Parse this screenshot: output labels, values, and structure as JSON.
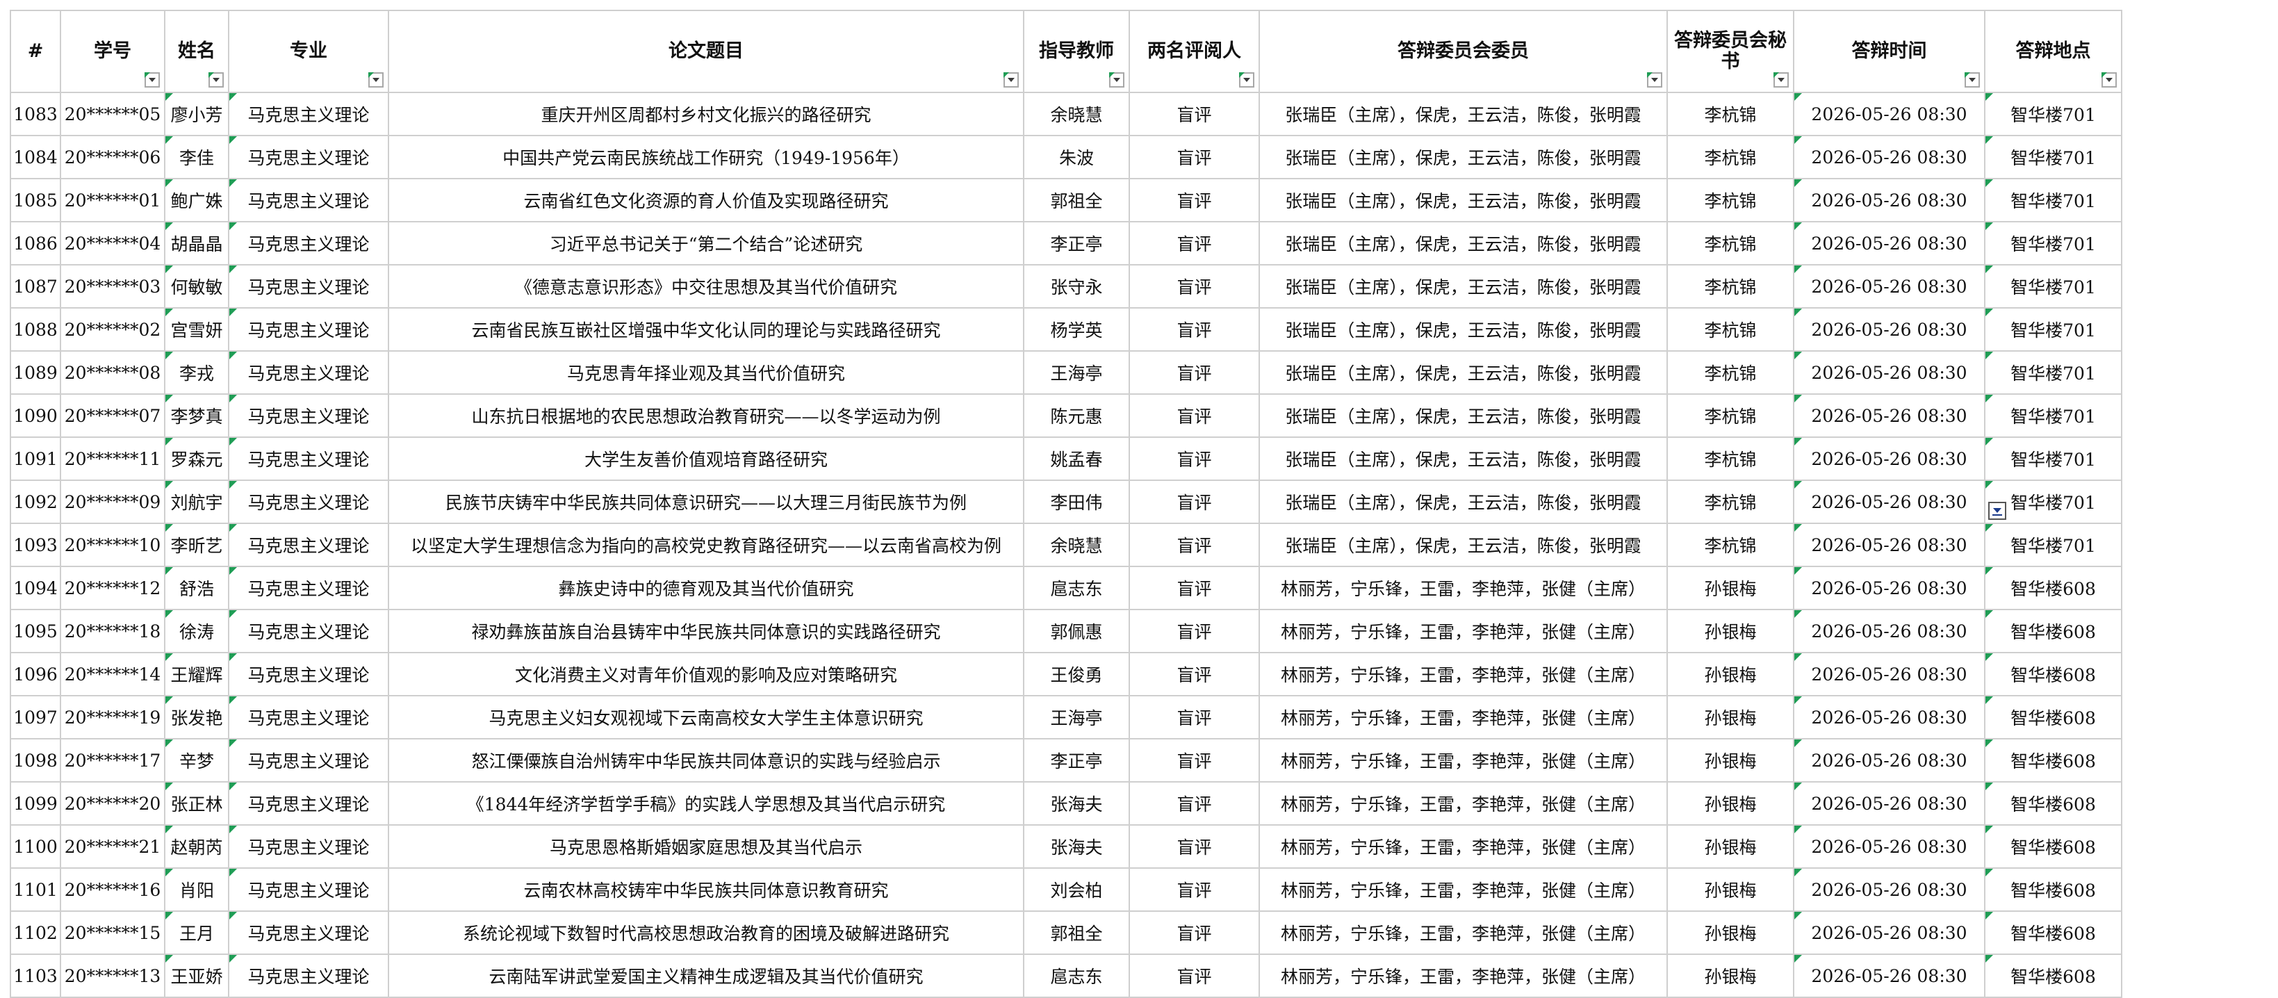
{
  "headers": {
    "num": "#",
    "student_id": "学号",
    "name": "姓名",
    "major": "专业",
    "title": "论文题目",
    "advisor": "指导教师",
    "reviewers": "两名评阅人",
    "committee": "答辩委员会委员",
    "secretary": "答辩委员会秘书",
    "time": "答辩时间",
    "location": "答辩地点"
  },
  "rows": [
    {
      "num": "1083",
      "id": "20******05",
      "name": "廖小芳",
      "major": "马克思主义理论",
      "title": "重庆开州区周都村乡村文化振兴的路径研究",
      "advisor": "余晓慧",
      "reviewers": "盲评",
      "committee": "张瑞臣（主席），保虎，王云洁，陈俊，张明霞",
      "secretary": "李杭锦",
      "time": "2026-05-26 08:30",
      "location": "智华楼701"
    },
    {
      "num": "1084",
      "id": "20******06",
      "name": "李佳",
      "major": "马克思主义理论",
      "title": "中国共产党云南民族统战工作研究（1949-1956年）",
      "advisor": "朱波",
      "reviewers": "盲评",
      "committee": "张瑞臣（主席），保虎，王云洁，陈俊，张明霞",
      "secretary": "李杭锦",
      "time": "2026-05-26 08:30",
      "location": "智华楼701"
    },
    {
      "num": "1085",
      "id": "20******01",
      "name": "鲍广姝",
      "major": "马克思主义理论",
      "title": "云南省红色文化资源的育人价值及实现路径研究",
      "advisor": "郭祖全",
      "reviewers": "盲评",
      "committee": "张瑞臣（主席），保虎，王云洁，陈俊，张明霞",
      "secretary": "李杭锦",
      "time": "2026-05-26 08:30",
      "location": "智华楼701"
    },
    {
      "num": "1086",
      "id": "20******04",
      "name": "胡晶晶",
      "major": "马克思主义理论",
      "title": "习近平总书记关于“第二个结合”论述研究",
      "advisor": "李正亭",
      "reviewers": "盲评",
      "committee": "张瑞臣（主席），保虎，王云洁，陈俊，张明霞",
      "secretary": "李杭锦",
      "time": "2026-05-26 08:30",
      "location": "智华楼701"
    },
    {
      "num": "1087",
      "id": "20******03",
      "name": "何敏敏",
      "major": "马克思主义理论",
      "title": "《德意志意识形态》中交往思想及其当代价值研究",
      "advisor": "张守永",
      "reviewers": "盲评",
      "committee": "张瑞臣（主席），保虎，王云洁，陈俊，张明霞",
      "secretary": "李杭锦",
      "time": "2026-05-26 08:30",
      "location": "智华楼701"
    },
    {
      "num": "1088",
      "id": "20******02",
      "name": "宫雪妍",
      "major": "马克思主义理论",
      "title": "云南省民族互嵌社区增强中华文化认同的理论与实践路径研究",
      "advisor": "杨学英",
      "reviewers": "盲评",
      "committee": "张瑞臣（主席），保虎，王云洁，陈俊，张明霞",
      "secretary": "李杭锦",
      "time": "2026-05-26 08:30",
      "location": "智华楼701"
    },
    {
      "num": "1089",
      "id": "20******08",
      "name": "李戎",
      "major": "马克思主义理论",
      "title": "马克思青年择业观及其当代价值研究",
      "advisor": "王海亭",
      "reviewers": "盲评",
      "committee": "张瑞臣（主席），保虎，王云洁，陈俊，张明霞",
      "secretary": "李杭锦",
      "time": "2026-05-26 08:30",
      "location": "智华楼701"
    },
    {
      "num": "1090",
      "id": "20******07",
      "name": "李梦真",
      "major": "马克思主义理论",
      "title": "山东抗日根据地的农民思想政治教育研究——以冬学运动为例",
      "advisor": "陈元惠",
      "reviewers": "盲评",
      "committee": "张瑞臣（主席），保虎，王云洁，陈俊，张明霞",
      "secretary": "李杭锦",
      "time": "2026-05-26 08:30",
      "location": "智华楼701"
    },
    {
      "num": "1091",
      "id": "20******11",
      "name": "罗森元",
      "major": "马克思主义理论",
      "title": "大学生友善价值观培育路径研究",
      "advisor": "姚孟春",
      "reviewers": "盲评",
      "committee": "张瑞臣（主席），保虎，王云洁，陈俊，张明霞",
      "secretary": "李杭锦",
      "time": "2026-05-26 08:30",
      "location": "智华楼701"
    },
    {
      "num": "1092",
      "id": "20******09",
      "name": "刘航宇",
      "major": "马克思主义理论",
      "title": "民族节庆铸牢中华民族共同体意识研究——以大理三月街民族节为例",
      "advisor": "李田伟",
      "reviewers": "盲评",
      "committee": "张瑞臣（主席），保虎，王云洁，陈俊，张明霞",
      "secretary": "李杭锦",
      "time": "2026-05-26 08:30",
      "location": "智华楼701"
    },
    {
      "num": "1093",
      "id": "20******10",
      "name": "李昕艺",
      "major": "马克思主义理论",
      "title": "以坚定大学生理想信念为指向的高校党史教育路径研究——以云南省高校为例",
      "advisor": "余晓慧",
      "reviewers": "盲评",
      "committee": "张瑞臣（主席），保虎，王云洁，陈俊，张明霞",
      "secretary": "李杭锦",
      "time": "2026-05-26 08:30",
      "location": "智华楼701"
    },
    {
      "num": "1094",
      "id": "20******12",
      "name": "舒浩",
      "major": "马克思主义理论",
      "title": "彝族史诗中的德育观及其当代价值研究",
      "advisor": "扈志东",
      "reviewers": "盲评",
      "committee": "林丽芳，宁乐锋，王雷，李艳萍，张健（主席）",
      "secretary": "孙银梅",
      "time": "2026-05-26 08:30",
      "location": "智华楼608"
    },
    {
      "num": "1095",
      "id": "20******18",
      "name": "徐涛",
      "major": "马克思主义理论",
      "title": "禄劝彝族苗族自治县铸牢中华民族共同体意识的实践路径研究",
      "advisor": "郭佩惠",
      "reviewers": "盲评",
      "committee": "林丽芳，宁乐锋，王雷，李艳萍，张健（主席）",
      "secretary": "孙银梅",
      "time": "2026-05-26 08:30",
      "location": "智华楼608"
    },
    {
      "num": "1096",
      "id": "20******14",
      "name": "王耀辉",
      "major": "马克思主义理论",
      "title": "文化消费主义对青年价值观的影响及应对策略研究",
      "advisor": "王俊勇",
      "reviewers": "盲评",
      "committee": "林丽芳，宁乐锋，王雷，李艳萍，张健（主席）",
      "secretary": "孙银梅",
      "time": "2026-05-26 08:30",
      "location": "智华楼608"
    },
    {
      "num": "1097",
      "id": "20******19",
      "name": "张发艳",
      "major": "马克思主义理论",
      "title": "马克思主义妇女观视域下云南高校女大学生主体意识研究",
      "advisor": "王海亭",
      "reviewers": "盲评",
      "committee": "林丽芳，宁乐锋，王雷，李艳萍，张健（主席）",
      "secretary": "孙银梅",
      "time": "2026-05-26 08:30",
      "location": "智华楼608"
    },
    {
      "num": "1098",
      "id": "20******17",
      "name": "辛梦",
      "major": "马克思主义理论",
      "title": "怒江傈僳族自治州铸牢中华民族共同体意识的实践与经验启示",
      "advisor": "李正亭",
      "reviewers": "盲评",
      "committee": "林丽芳，宁乐锋，王雷，李艳萍，张健（主席）",
      "secretary": "孙银梅",
      "time": "2026-05-26 08:30",
      "location": "智华楼608"
    },
    {
      "num": "1099",
      "id": "20******20",
      "name": "张正林",
      "major": "马克思主义理论",
      "title": "《1844年经济学哲学手稿》的实践人学思想及其当代启示研究",
      "advisor": "张海夫",
      "reviewers": "盲评",
      "committee": "林丽芳，宁乐锋，王雷，李艳萍，张健（主席）",
      "secretary": "孙银梅",
      "time": "2026-05-26 08:30",
      "location": "智华楼608"
    },
    {
      "num": "1100",
      "id": "20******21",
      "name": "赵朝芮",
      "major": "马克思主义理论",
      "title": "马克思恩格斯婚姻家庭思想及其当代启示",
      "advisor": "张海夫",
      "reviewers": "盲评",
      "committee": "林丽芳，宁乐锋，王雷，李艳萍，张健（主席）",
      "secretary": "孙银梅",
      "time": "2026-05-26 08:30",
      "location": "智华楼608"
    },
    {
      "num": "1101",
      "id": "20******16",
      "name": "肖阳",
      "major": "马克思主义理论",
      "title": "云南农林高校铸牢中华民族共同体意识教育研究",
      "advisor": "刘会柏",
      "reviewers": "盲评",
      "committee": "林丽芳，宁乐锋，王雷，李艳萍，张健（主席）",
      "secretary": "孙银梅",
      "time": "2026-05-26 08:30",
      "location": "智华楼608"
    },
    {
      "num": "1102",
      "id": "20******15",
      "name": "王月",
      "major": "马克思主义理论",
      "title": "系统论视域下数智时代高校思想政治教育的困境及破解进路研究",
      "advisor": "郭祖全",
      "reviewers": "盲评",
      "committee": "林丽芳，宁乐锋，王雷，李艳萍，张健（主席）",
      "secretary": "孙银梅",
      "time": "2026-05-26 08:30",
      "location": "智华楼608"
    },
    {
      "num": "1103",
      "id": "20******13",
      "name": "王亚娇",
      "major": "马克思主义理论",
      "title": "云南陆军讲武堂爱国主义精神生成逻辑及其当代价值研究",
      "advisor": "扈志东",
      "reviewers": "盲评",
      "committee": "林丽芳，宁乐锋，王雷，李艳萍，张健（主席）",
      "secretary": "孙银梅",
      "time": "2026-05-26 08:30",
      "location": "智华楼608"
    }
  ],
  "accent_green": "#1f9d55",
  "grid_color": "#cfcfcf",
  "filter_icon": "filter-dropdown-icon",
  "active_cell_icon": "dropdown-arrow-icon"
}
